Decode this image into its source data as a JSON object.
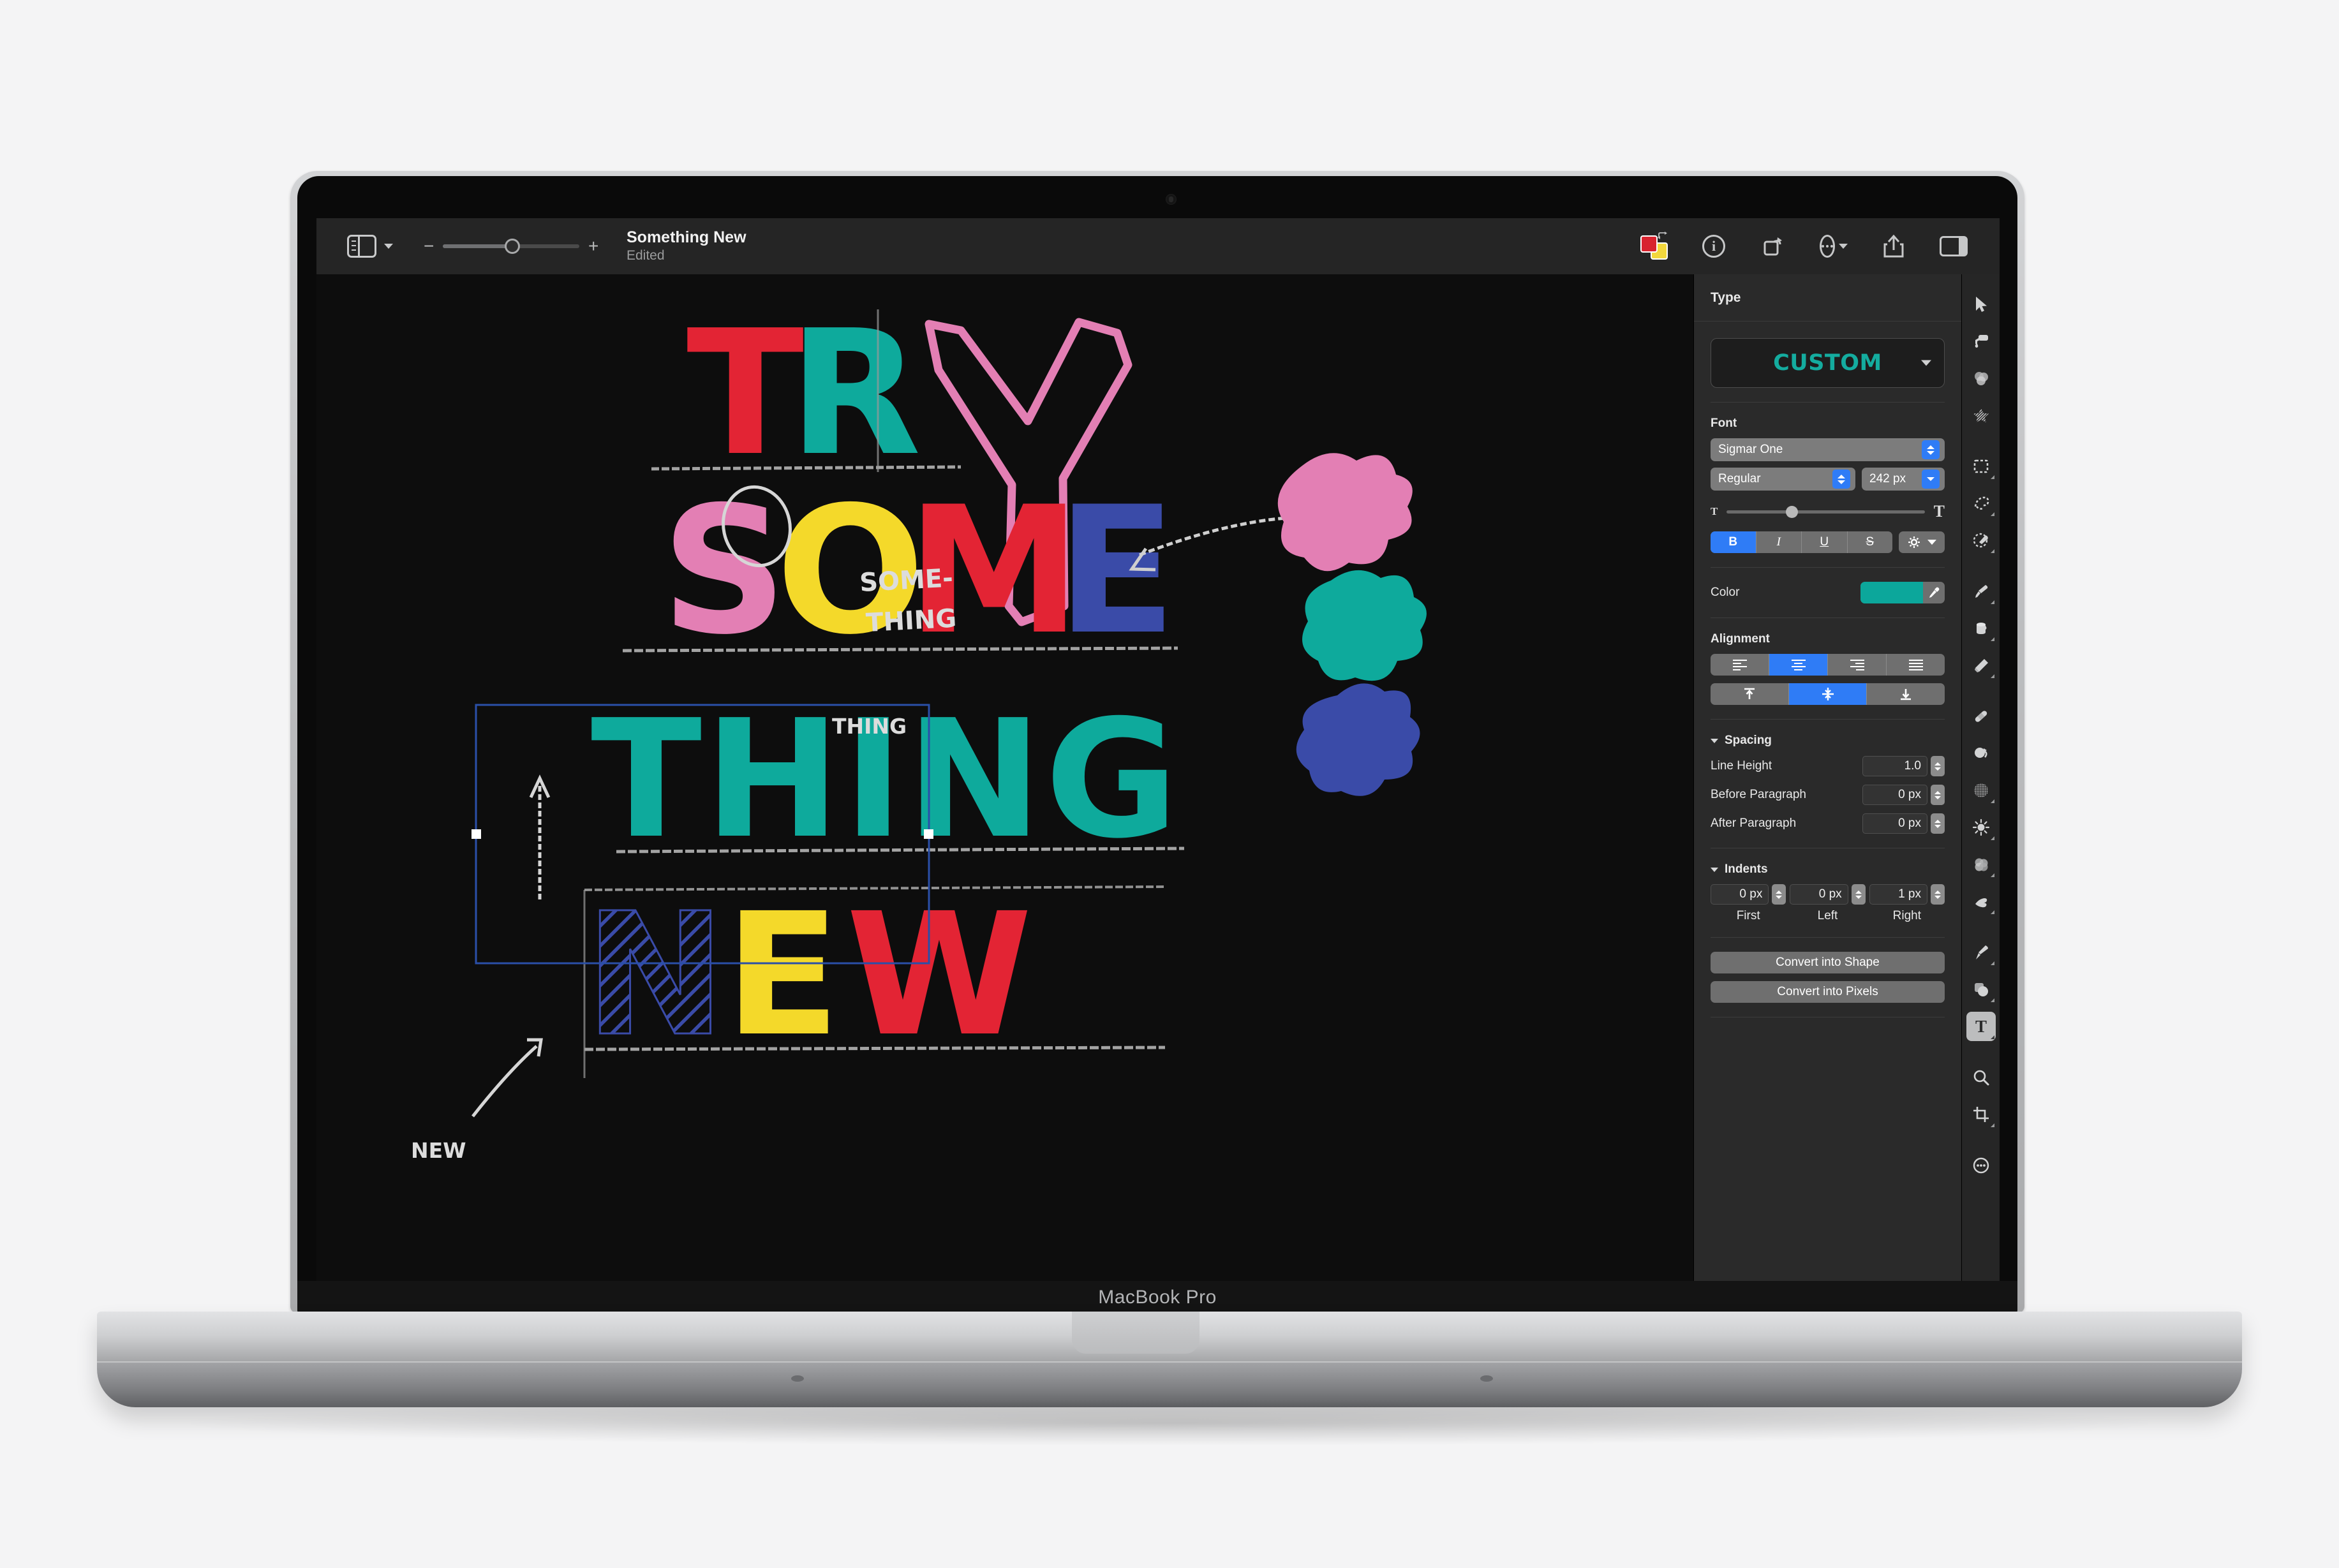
{
  "device": {
    "brand_label": "MacBook Pro"
  },
  "app": {
    "titlebar": {
      "sidebar_toggle": "sidebar-toggle",
      "zoom_out": "−",
      "zoom_in": "+",
      "document_title": "Something New",
      "document_status": "Edited",
      "right_icons": [
        {
          "name": "color-swatches-icon",
          "label": "Colours"
        },
        {
          "name": "info-icon",
          "label": "i"
        },
        {
          "name": "rotate-icon",
          "label": "Rotate"
        },
        {
          "name": "more-options-icon",
          "label": "More"
        },
        {
          "name": "share-icon",
          "label": "Share"
        },
        {
          "name": "toggle-panel-icon",
          "label": "Panel"
        }
      ]
    },
    "inspector": {
      "title": "Type",
      "type_preset": "CUSTOM",
      "font_section_label": "Font",
      "font_family": "Sigmar One",
      "font_style": "Regular",
      "font_size": "242 px",
      "style_buttons": [
        {
          "label": "B",
          "active": true
        },
        {
          "label": "I",
          "active": false
        },
        {
          "label": "U",
          "active": false
        },
        {
          "label": "S",
          "active": false
        }
      ],
      "color_label": "Color",
      "color_value": "#0ca79b",
      "alignment_label": "Alignment",
      "horizontal_alignment": [
        {
          "name": "align-left",
          "active": false
        },
        {
          "name": "align-center",
          "active": true
        },
        {
          "name": "align-right",
          "active": false
        },
        {
          "name": "align-justify",
          "active": false
        }
      ],
      "vertical_alignment": [
        {
          "name": "align-top",
          "active": false
        },
        {
          "name": "align-middle",
          "active": true
        },
        {
          "name": "align-bottom",
          "active": false
        }
      ],
      "spacing_label": "Spacing",
      "spacing_rows": [
        {
          "label": "Line Height",
          "value": "1.0"
        },
        {
          "label": "Before Paragraph",
          "value": "0 px"
        },
        {
          "label": "After Paragraph",
          "value": "0 px"
        }
      ],
      "indents_label": "Indents",
      "indents": [
        {
          "caption": "First",
          "value": "0 px"
        },
        {
          "caption": "Left",
          "value": "0 px"
        },
        {
          "caption": "Right",
          "value": "1 px"
        }
      ],
      "convert_shape_label": "Convert into Shape",
      "convert_pixels_label": "Convert into Pixels"
    },
    "tools": [
      {
        "name": "move-tool",
        "selected": false,
        "submenu": false
      },
      {
        "name": "paint-roller-tool",
        "selected": false,
        "submenu": false
      },
      {
        "name": "color-blobs-tool",
        "selected": false,
        "submenu": false
      },
      {
        "name": "shimmer-star-tool",
        "selected": false,
        "submenu": false
      },
      {
        "name": "rectangle-marquee-tool",
        "selected": false,
        "submenu": true
      },
      {
        "name": "freehand-selection-tool",
        "selected": false,
        "submenu": true
      },
      {
        "name": "selection-brush-tool",
        "selected": false,
        "submenu": true
      },
      {
        "name": "paint-brush-tool",
        "selected": false,
        "submenu": true
      },
      {
        "name": "paint-bucket-tool",
        "selected": false,
        "submenu": true
      },
      {
        "name": "eraser-tool",
        "selected": false,
        "submenu": true
      },
      {
        "name": "healing-brush-tool",
        "selected": false,
        "submenu": false
      },
      {
        "name": "clone-stamp-tool",
        "selected": false,
        "submenu": false
      },
      {
        "name": "dither-tool",
        "selected": false,
        "submenu": true
      },
      {
        "name": "dodge-burn-tool",
        "selected": false,
        "submenu": true
      },
      {
        "name": "blur-smudge-tool",
        "selected": false,
        "submenu": true
      },
      {
        "name": "pinch-tool",
        "selected": false,
        "submenu": true
      },
      {
        "name": "pen-tool",
        "selected": false,
        "submenu": true
      },
      {
        "name": "shape-tool",
        "selected": false,
        "submenu": true
      },
      {
        "name": "text-tool",
        "selected": true,
        "submenu": true
      },
      {
        "name": "zoom-tool",
        "selected": false,
        "submenu": false
      },
      {
        "name": "crop-tool",
        "selected": false,
        "submenu": true
      },
      {
        "name": "more-tools",
        "selected": false,
        "submenu": false
      }
    ],
    "canvas": {
      "artwork_lines": [
        {
          "text": "TRY",
          "letters": [
            {
              "ch": "T",
              "color": "#e32434"
            },
            {
              "ch": "R",
              "color": "#0eaa9c"
            },
            {
              "ch": "Y",
              "color": "#e37fb4"
            }
          ]
        },
        {
          "text": "SOME",
          "letters": [
            {
              "ch": "S",
              "color": "#e37fb4"
            },
            {
              "ch": "O",
              "color": "#f4d92a"
            },
            {
              "ch": "M",
              "color": "#e32434"
            },
            {
              "ch": "E",
              "color": "#3a4ba8"
            }
          ]
        },
        {
          "text": "THING",
          "letters": [
            {
              "ch": "T",
              "color": "#0eaa9c"
            },
            {
              "ch": "H",
              "color": "#0eaa9c"
            },
            {
              "ch": "I",
              "color": "#0eaa9c"
            },
            {
              "ch": "N",
              "color": "#0eaa9c"
            },
            {
              "ch": "G",
              "color": "#0eaa9c"
            }
          ]
        },
        {
          "text": "NEW",
          "letters": [
            {
              "ch": "N",
              "color": "#3a4ba8"
            },
            {
              "ch": "E",
              "color": "#f4d92a"
            },
            {
              "ch": "W",
              "color": "#e32434"
            }
          ]
        }
      ],
      "annotations": [
        {
          "text": "SOME-",
          "name": "annotation-some"
        },
        {
          "text": "THING",
          "name": "annotation-thing-1"
        },
        {
          "text": "THING",
          "name": "annotation-thing-2"
        },
        {
          "text": "NEW",
          "name": "annotation-new"
        }
      ],
      "blobs": [
        {
          "name": "blob-pink",
          "color": "#e37fb4"
        },
        {
          "name": "blob-teal",
          "color": "#0eaa9c"
        },
        {
          "name": "blob-blue",
          "color": "#3a4ba8"
        }
      ]
    }
  }
}
